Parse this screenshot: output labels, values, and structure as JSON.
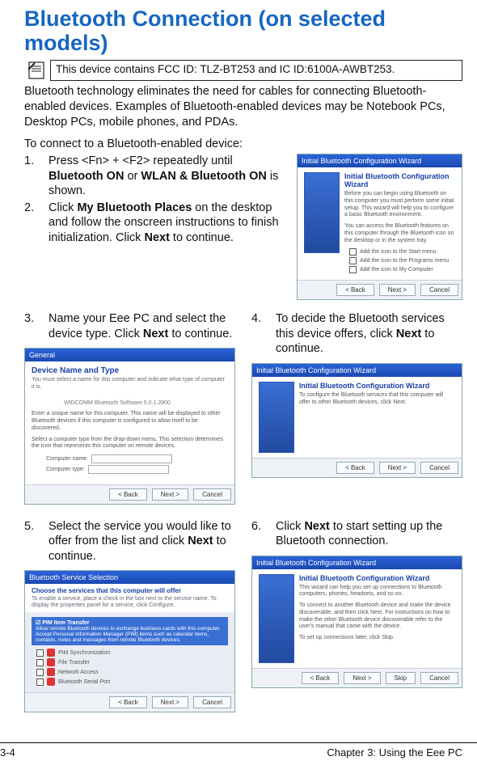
{
  "title": "Bluetooth Connection (on selected models)",
  "note_text": "This device contains FCC ID: TLZ-BT253 and IC ID:6100A-AWBT253.",
  "intro": "Bluetooth technology eliminates the need for cables for connecting Bluetooth-enabled devices. Examples of Bluetooth-enabled devices may be Notebook PCs, Desktop PCs, mobile phones, and PDAs.",
  "lead": "To connect to a Bluetooth-enabled device:",
  "steps": {
    "s1": {
      "num": "1.",
      "pre": "Press <Fn> + <F2> repeatedly until ",
      "b1": "Bluetooth ON",
      "mid": " or ",
      "b2": "WLAN & Bluetooth ON",
      "post": " is shown."
    },
    "s2": {
      "num": "2.",
      "pre": "Click ",
      "b1": "My Bluetooth Places",
      "mid": " on the desktop and follow the onscreen instructions to finish initialization. Click ",
      "b2": "Next",
      "post": " to continue."
    },
    "s3": {
      "num": "3.",
      "pre": "Name your Eee PC and select the device type. Click ",
      "b1": "Next",
      "post": " to continue."
    },
    "s4": {
      "num": "4.",
      "pre": "To decide the Bluetooth services this device offers, click ",
      "b1": "Next",
      "post": " to continue."
    },
    "s5": {
      "num": "5.",
      "pre": "Select the service you would like to offer from the list and click ",
      "b1": "Next",
      "post": " to continue."
    },
    "s6": {
      "num": "6.",
      "pre": "Click ",
      "b1": "Next",
      "post": " to start setting up the Bluetooth connection."
    }
  },
  "mock": {
    "titlebar": "Initial Bluetooth Configuration Wizard",
    "config_title": "Initial Bluetooth Configuration Wizard",
    "hdr_general": "General",
    "hdr_devicename": "Device Name and Type",
    "hdr_devicesub": "You must select a name for this computer and indicate what type of computer it is.",
    "hdr_svc": "Bluetooth Service Selection",
    "hdr_svcsub": "Choose the services that this computer will offer",
    "btn_back": "< Back",
    "btn_next": "Next >",
    "btn_cancel": "Cancel",
    "btn_skip": "Skip"
  },
  "footer": {
    "page": "3-4",
    "chapter": "Chapter 3: Using the Eee PC"
  }
}
